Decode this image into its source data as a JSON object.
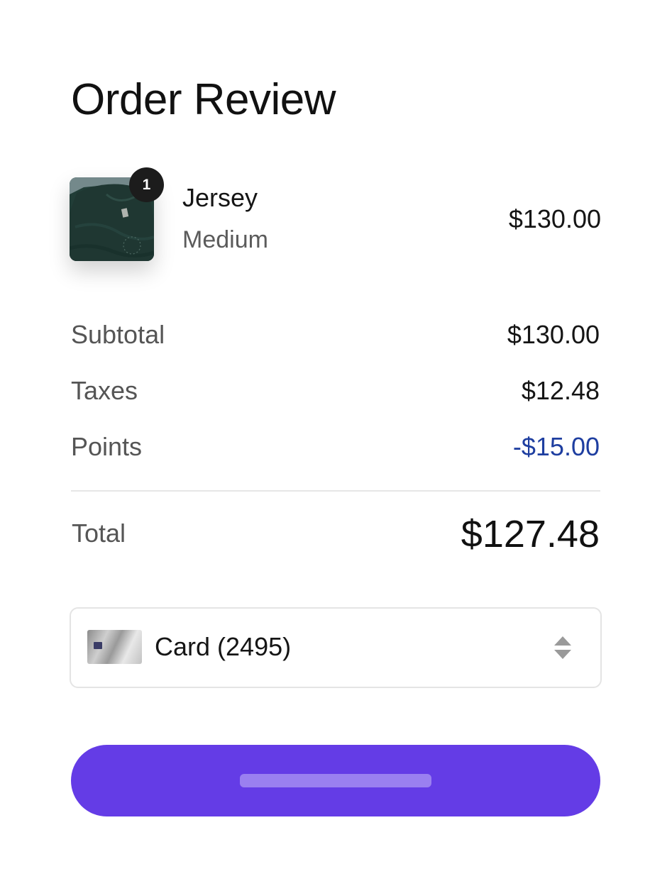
{
  "page": {
    "title": "Order Review"
  },
  "line_item": {
    "quantity": "1",
    "name": "Jersey",
    "variant": "Medium",
    "price": "$130.00",
    "image_icon": "tshirt-thumbnail"
  },
  "summary": {
    "rows": [
      {
        "label": "Subtotal",
        "value": "$130.00"
      },
      {
        "label": "Taxes",
        "value": "$12.48"
      },
      {
        "label": "Points",
        "value": "-$15.00"
      }
    ],
    "total_label": "Total",
    "total_value": "$127.48"
  },
  "payment": {
    "selected": "Card (2495)",
    "card_icon": "credit-card-icon",
    "selector_icon": "chevron-up-down-icon"
  },
  "actions": {
    "primary_label": ""
  },
  "colors": {
    "accent": "#643ce6",
    "discount": "#1e3ea0",
    "badge": "#1c1c1c"
  }
}
